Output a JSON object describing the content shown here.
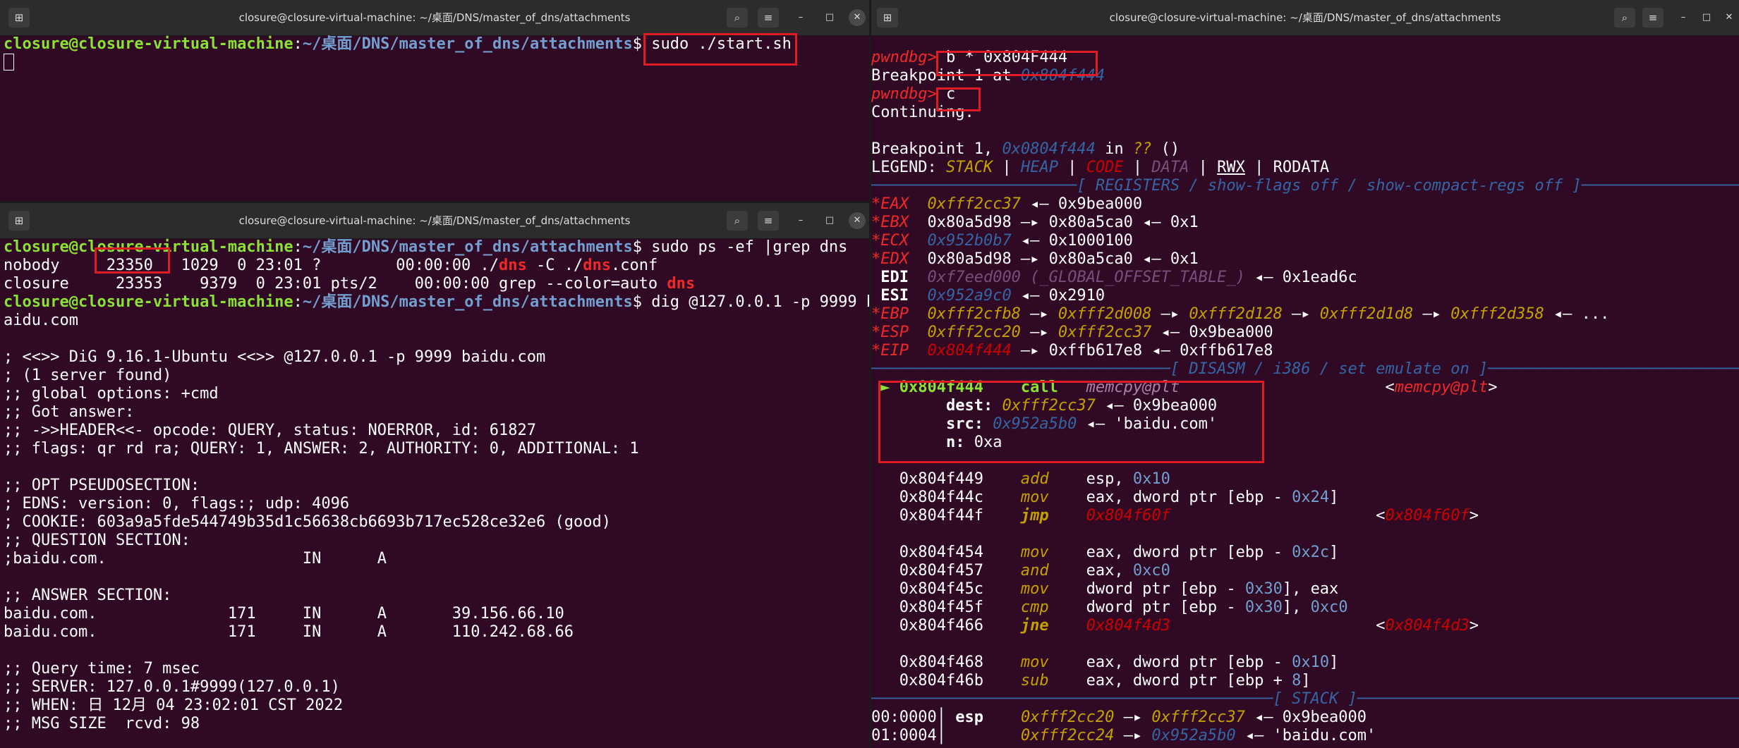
{
  "colors": {
    "terminal_bg": "#300a24",
    "titlebar_bg": "#2c2c2c",
    "prompt_user": "#8ae234",
    "prompt_path": "#729fcf",
    "highlight_box": "#e01b24"
  },
  "icons": {
    "new_tab": "new-tab-icon",
    "search": "search-icon",
    "menu": "hamburger-menu-icon",
    "minimize": "minimize-icon",
    "maximize": "maximize-icon",
    "close": "close-icon"
  },
  "window_title": "closure@closure-virtual-machine: ~/桌面/DNS/master_of_dns/attachments",
  "prompt": {
    "user_host": "closure@closure-virtual-machine",
    "sep": ":",
    "path": "~/桌面/DNS/master_of_dns/attachments",
    "sigil": "$"
  },
  "term1": {
    "command": " sudo ./start.sh"
  },
  "term2": {
    "command1": " sudo ps -ef |grep dns",
    "ps_rows": [
      {
        "pre": "nobody    ",
        "pid": " 23350",
        "mid": "   1029  0 23:01 ?        00:00:00 ./",
        "m1": "dns",
        "mid2": " -C ./",
        "m2": "dns",
        "post": ".conf"
      },
      {
        "pre": "closure     23353    9379  0 23:01 pts/2    00:00:00 grep --color=auto ",
        "pid": "",
        "mid": "",
        "m1": "dns",
        "mid2": "",
        "m2": "",
        "post": ""
      }
    ],
    "command2": " dig @127.0.0.1 -p 9999 b",
    "command2_wrap": "aidu.com",
    "dig_output": [
      "",
      "; <<>> DiG 9.16.1-Ubuntu <<>> @127.0.0.1 -p 9999 baidu.com",
      "; (1 server found)",
      ";; global options: +cmd",
      ";; Got answer:",
      ";; ->>HEADER<<- opcode: QUERY, status: NOERROR, id: 61827",
      ";; flags: qr rd ra; QUERY: 1, ANSWER: 2, AUTHORITY: 0, ADDITIONAL: 1",
      "",
      ";; OPT PSEUDOSECTION:",
      "; EDNS: version: 0, flags:; udp: 4096",
      "; COOKIE: 603a9a5fde544749b35d1c56638cb6693b717ec528ce32e6 (good)",
      ";; QUESTION SECTION:",
      ";baidu.com.                     IN      A",
      "",
      ";; ANSWER SECTION:",
      "baidu.com.              171     IN      A       39.156.66.10",
      "baidu.com.              171     IN      A       110.242.68.66",
      "",
      ";; Query time: 7 msec",
      ";; SERVER: 127.0.0.1#9999(127.0.0.1)",
      ";; WHEN: 日 12月 04 23:02:01 CST 2022",
      ";; MSG SIZE  rcvd: 98"
    ]
  },
  "term3": {
    "lines": [
      [
        {
          "t": "pwndbg> ",
          "c": "#ef2929"
        },
        {
          "t": "b * 0x804F444",
          "c": "#ffffff"
        }
      ],
      [
        {
          "t": "Breakpoint 1 at ",
          "c": "#ffffff"
        },
        {
          "t": "0x804f444",
          "c": "#3465a4"
        }
      ],
      [
        {
          "t": "pwndbg> ",
          "c": "#ef2929"
        },
        {
          "t": "c",
          "c": "#ffffff"
        }
      ],
      [
        {
          "t": "Continuing.",
          "c": "#ffffff"
        }
      ],
      [
        {
          "t": "",
          "c": "#ffffff"
        }
      ],
      [
        {
          "t": "Breakpoint 1, ",
          "c": "#ffffff"
        },
        {
          "t": "0x0804f444",
          "c": "#3465a4"
        },
        {
          "t": " in ",
          "c": "#ffffff"
        },
        {
          "t": "??",
          "c": "#c4a000"
        },
        {
          "t": " ()",
          "c": "#ffffff"
        }
      ],
      [
        {
          "t": "LEGEND: ",
          "c": "#ffffff"
        },
        {
          "t": "STACK",
          "c": "#c4a000"
        },
        {
          "t": " | ",
          "c": "#ffffff"
        },
        {
          "t": "HEAP",
          "c": "#3465a4"
        },
        {
          "t": " | ",
          "c": "#ffffff"
        },
        {
          "t": "CODE",
          "c": "#cc0000"
        },
        {
          "t": " | ",
          "c": "#ffffff"
        },
        {
          "t": "DATA",
          "c": "#75507b"
        },
        {
          "t": " | ",
          "c": "#ffffff"
        },
        {
          "t": "RWX",
          "c": "#ffffff",
          "u": true
        },
        {
          "t": " | RODATA",
          "c": "#ffffff"
        }
      ],
      [
        {
          "t": "──────────────────────[ REGISTERS / show-flags off / show-compact-regs off ]──────────────────────",
          "c": "#3465a4"
        }
      ],
      [
        {
          "t": "*EAX ",
          "c": "#ef2929"
        },
        {
          "t": " 0xfff2cc37",
          "c": "#c4a000"
        },
        {
          "t": " ◂— 0x9bea000",
          "c": "#ffffff"
        }
      ],
      [
        {
          "t": "*EBX ",
          "c": "#ef2929"
        },
        {
          "t": " 0x80a5d98 —▸ 0x80a5ca0 ◂— 0x1",
          "c": "#ffffff"
        }
      ],
      [
        {
          "t": "*ECX ",
          "c": "#ef2929"
        },
        {
          "t": " 0x952b0b7",
          "c": "#3465a4"
        },
        {
          "t": " ◂— 0x1000100",
          "c": "#ffffff"
        }
      ],
      [
        {
          "t": "*EDX ",
          "c": "#ef2929"
        },
        {
          "t": " 0x80a5d98 —▸ 0x80a5ca0 ◂— 0x1",
          "c": "#ffffff"
        }
      ],
      [
        {
          "t": " EDI ",
          "c": "#ffffff",
          "b": true
        },
        {
          "t": " 0xf7eed000 (_GLOBAL_OFFSET_TABLE_)",
          "c": "#75507b"
        },
        {
          "t": " ◂— 0x1ead6c",
          "c": "#ffffff"
        }
      ],
      [
        {
          "t": " ESI ",
          "c": "#ffffff",
          "b": true
        },
        {
          "t": " 0x952a9c0",
          "c": "#3465a4"
        },
        {
          "t": " ◂— 0x2910",
          "c": "#ffffff"
        }
      ],
      [
        {
          "t": "*EBP ",
          "c": "#ef2929"
        },
        {
          "t": " 0xfff2cfb8",
          "c": "#c4a000"
        },
        {
          "t": " —▸ ",
          "c": "#ffffff"
        },
        {
          "t": "0xfff2d008",
          "c": "#c4a000"
        },
        {
          "t": " —▸ ",
          "c": "#ffffff"
        },
        {
          "t": "0xfff2d128",
          "c": "#c4a000"
        },
        {
          "t": " —▸ ",
          "c": "#ffffff"
        },
        {
          "t": "0xfff2d1d8",
          "c": "#c4a000"
        },
        {
          "t": " —▸ ",
          "c": "#ffffff"
        },
        {
          "t": "0xfff2d358",
          "c": "#c4a000"
        },
        {
          "t": " ◂— ...",
          "c": "#ffffff"
        }
      ],
      [
        {
          "t": "*ESP ",
          "c": "#ef2929"
        },
        {
          "t": " 0xfff2cc20",
          "c": "#c4a000"
        },
        {
          "t": " —▸ ",
          "c": "#ffffff"
        },
        {
          "t": "0xfff2cc37",
          "c": "#c4a000"
        },
        {
          "t": " ◂— 0x9bea000",
          "c": "#ffffff"
        }
      ],
      [
        {
          "t": "*EIP ",
          "c": "#ef2929"
        },
        {
          "t": " 0x804f444",
          "c": "#cc0000"
        },
        {
          "t": " —▸ 0xffb617e8 ◂— 0xffb617e8",
          "c": "#ffffff"
        }
      ],
      [
        {
          "t": "────────────────────────────────[ DISASM / i386 / set emulate on ]────────────────────────────────",
          "c": "#3465a4"
        }
      ],
      [
        {
          "t": " ► 0x804f444    call   ",
          "c": "#8ae234",
          "b": true
        },
        {
          "t": "memcpy@plt",
          "c": "#ad7fa8"
        },
        {
          "t": "                      <",
          "c": "#ffffff"
        },
        {
          "t": "memcpy@plt",
          "c": "#ef2929"
        },
        {
          "t": ">",
          "c": "#ffffff"
        }
      ],
      [
        {
          "t": "        dest: ",
          "c": "#ffffff",
          "b": true
        },
        {
          "t": "0xfff2cc37",
          "c": "#c4a000"
        },
        {
          "t": " ◂— 0x9bea000",
          "c": "#ffffff"
        }
      ],
      [
        {
          "t": "        src: ",
          "c": "#ffffff",
          "b": true
        },
        {
          "t": "0x952a5b0",
          "c": "#3465a4"
        },
        {
          "t": " ◂— 'baidu.com'",
          "c": "#ffffff"
        }
      ],
      [
        {
          "t": "        n: ",
          "c": "#ffffff",
          "b": true
        },
        {
          "t": "0xa",
          "c": "#ffffff"
        }
      ],
      [
        {
          "t": "",
          "c": "#ffffff"
        }
      ],
      [
        {
          "t": "   0x804f449    ",
          "c": "#ffffff"
        },
        {
          "t": "add    ",
          "c": "#c4a000"
        },
        {
          "t": "esp",
          "c": "#ffffff"
        },
        {
          "t": ", ",
          "c": "#ffffff"
        },
        {
          "t": "0x10",
          "c": "#729fcf"
        }
      ],
      [
        {
          "t": "   0x804f44c    ",
          "c": "#ffffff"
        },
        {
          "t": "mov    ",
          "c": "#c4a000"
        },
        {
          "t": "eax",
          "c": "#ffffff"
        },
        {
          "t": ", dword ptr [",
          "c": "#ffffff"
        },
        {
          "t": "ebp",
          "c": "#ffffff"
        },
        {
          "t": " - ",
          "c": "#ffffff"
        },
        {
          "t": "0x24",
          "c": "#729fcf"
        },
        {
          "t": "]",
          "c": "#ffffff"
        }
      ],
      [
        {
          "t": "   0x804f44f    ",
          "c": "#ffffff"
        },
        {
          "t": "jmp    ",
          "c": "#c4a000",
          "b": true
        },
        {
          "t": "0x804f60f",
          "c": "#cc0000"
        },
        {
          "t": "                      <",
          "c": "#ffffff"
        },
        {
          "t": "0x804f60f",
          "c": "#cc0000"
        },
        {
          "t": ">",
          "c": "#ffffff"
        }
      ],
      [
        {
          "t": "",
          "c": "#ffffff"
        }
      ],
      [
        {
          "t": "   0x804f454    ",
          "c": "#ffffff"
        },
        {
          "t": "mov    ",
          "c": "#c4a000"
        },
        {
          "t": "eax",
          "c": "#ffffff"
        },
        {
          "t": ", dword ptr [",
          "c": "#ffffff"
        },
        {
          "t": "ebp",
          "c": "#ffffff"
        },
        {
          "t": " - ",
          "c": "#ffffff"
        },
        {
          "t": "0x2c",
          "c": "#729fcf"
        },
        {
          "t": "]",
          "c": "#ffffff"
        }
      ],
      [
        {
          "t": "   0x804f457    ",
          "c": "#ffffff"
        },
        {
          "t": "and    ",
          "c": "#c4a000"
        },
        {
          "t": "eax",
          "c": "#ffffff"
        },
        {
          "t": ", ",
          "c": "#ffffff"
        },
        {
          "t": "0xc0",
          "c": "#729fcf"
        }
      ],
      [
        {
          "t": "   0x804f45c    ",
          "c": "#ffffff"
        },
        {
          "t": "mov    ",
          "c": "#c4a000"
        },
        {
          "t": "dword ptr [",
          "c": "#ffffff"
        },
        {
          "t": "ebp",
          "c": "#ffffff"
        },
        {
          "t": " - ",
          "c": "#ffffff"
        },
        {
          "t": "0x30",
          "c": "#729fcf"
        },
        {
          "t": "], eax",
          "c": "#ffffff"
        }
      ],
      [
        {
          "t": "   0x804f45f    ",
          "c": "#ffffff"
        },
        {
          "t": "cmp    ",
          "c": "#c4a000"
        },
        {
          "t": "dword ptr [",
          "c": "#ffffff"
        },
        {
          "t": "ebp",
          "c": "#ffffff"
        },
        {
          "t": " - ",
          "c": "#ffffff"
        },
        {
          "t": "0x30",
          "c": "#729fcf"
        },
        {
          "t": "], ",
          "c": "#ffffff"
        },
        {
          "t": "0xc0",
          "c": "#729fcf"
        }
      ],
      [
        {
          "t": "   0x804f466    ",
          "c": "#ffffff"
        },
        {
          "t": "jne    ",
          "c": "#c4a000",
          "b": true
        },
        {
          "t": "0x804f4d3",
          "c": "#cc0000"
        },
        {
          "t": "                      <",
          "c": "#ffffff"
        },
        {
          "t": "0x804f4d3",
          "c": "#cc0000"
        },
        {
          "t": ">",
          "c": "#ffffff"
        }
      ],
      [
        {
          "t": "",
          "c": "#ffffff"
        }
      ],
      [
        {
          "t": "   0x804f468    ",
          "c": "#ffffff"
        },
        {
          "t": "mov    ",
          "c": "#c4a000"
        },
        {
          "t": "eax",
          "c": "#ffffff"
        },
        {
          "t": ", dword ptr [",
          "c": "#ffffff"
        },
        {
          "t": "ebp",
          "c": "#ffffff"
        },
        {
          "t": " - ",
          "c": "#ffffff"
        },
        {
          "t": "0x10",
          "c": "#729fcf"
        },
        {
          "t": "]",
          "c": "#ffffff"
        }
      ],
      [
        {
          "t": "   0x804f46b    ",
          "c": "#ffffff"
        },
        {
          "t": "sub    ",
          "c": "#c4a000"
        },
        {
          "t": "eax",
          "c": "#ffffff"
        },
        {
          "t": ", dword ptr [",
          "c": "#ffffff"
        },
        {
          "t": "ebp",
          "c": "#ffffff"
        },
        {
          "t": " + ",
          "c": "#ffffff"
        },
        {
          "t": "8",
          "c": "#729fcf"
        },
        {
          "t": "]",
          "c": "#ffffff"
        }
      ],
      [
        {
          "t": "───────────────────────────────────────────[ STACK ]───────────────────────────────────────────",
          "c": "#3465a4"
        }
      ],
      [
        {
          "t": "00:0000│ ",
          "c": "#ffffff"
        },
        {
          "t": "esp ",
          "c": "#ffffff",
          "b": true
        },
        {
          "t": "   0xfff2cc20",
          "c": "#c4a000"
        },
        {
          "t": " —▸ ",
          "c": "#ffffff"
        },
        {
          "t": "0xfff2cc37",
          "c": "#c4a000"
        },
        {
          "t": " ◂— 0x9bea000",
          "c": "#ffffff"
        }
      ],
      [
        {
          "t": "01:0004│     ",
          "c": "#ffffff"
        },
        {
          "t": "   0xfff2cc24",
          "c": "#c4a000"
        },
        {
          "t": " —▸ ",
          "c": "#ffffff"
        },
        {
          "t": "0x952a5b0",
          "c": "#3465a4"
        },
        {
          "t": " ◂— 'baidu.com'",
          "c": "#ffffff"
        }
      ]
    ]
  }
}
